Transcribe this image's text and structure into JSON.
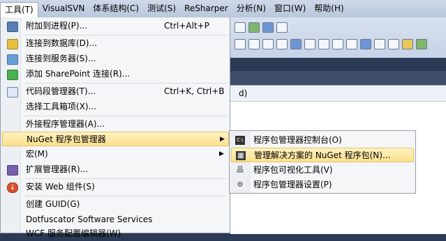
{
  "menubar": {
    "items": [
      "工具(T)",
      "VisualSVN",
      "体系结构(C)",
      "测试(S)",
      "ReSharper",
      "分析(N)",
      "窗口(W)",
      "帮助(H)"
    ]
  },
  "editor": {
    "doc_fragment": "d)"
  },
  "tools_menu": {
    "items": [
      {
        "label": "附加到进程(P)...",
        "shortcut": "Ctrl+Alt+P",
        "icon": "attach-process-icon"
      },
      {
        "label": "连接到数据库(D)...",
        "shortcut": "",
        "icon": "database-connect-icon"
      },
      {
        "label": "连接到服务器(S)...",
        "shortcut": "",
        "icon": "server-connect-icon"
      },
      {
        "label": "添加 SharePoint 连接(R)...",
        "shortcut": "",
        "icon": "sharepoint-icon"
      },
      {
        "label": "代码段管理器(T)...",
        "shortcut": "Ctrl+K, Ctrl+B",
        "icon": "code-snippet-icon"
      },
      {
        "label": "选择工具箱项(X)...",
        "shortcut": "",
        "icon": ""
      },
      {
        "label": "外接程序管理器(A)...",
        "shortcut": "",
        "icon": ""
      },
      {
        "label": "NuGet 程序包管理器",
        "shortcut": "",
        "icon": ""
      },
      {
        "label": "宏(M)",
        "shortcut": "",
        "icon": ""
      },
      {
        "label": "扩展管理器(R)...",
        "shortcut": "",
        "icon": "extension-manager-icon"
      },
      {
        "label": "安装 Web 组件(S)",
        "shortcut": "",
        "icon": "web-install-icon"
      },
      {
        "label": "创建 GUID(G)",
        "shortcut": "",
        "icon": ""
      },
      {
        "label": "Dotfuscator Software Services",
        "shortcut": "",
        "icon": ""
      },
      {
        "label": "WCF 服务配置编辑器(W)",
        "shortcut": "",
        "icon": ""
      }
    ]
  },
  "nuget_submenu": {
    "items": [
      {
        "label": "程序包管理器控制台(O)",
        "icon": "console-icon"
      },
      {
        "label": "管理解决方案的 NuGet 程序包(N)...",
        "icon": "nuget-package-icon"
      },
      {
        "label": "程序包可视化工具(V)",
        "icon": "visualizer-icon"
      },
      {
        "label": "程序包管理器设置(P)",
        "icon": "settings-gear-icon"
      }
    ]
  },
  "colors": {
    "highlight": "#fbe08e",
    "menu_bg": "#f5f6f8",
    "dark_bg": "#2b3a55"
  }
}
